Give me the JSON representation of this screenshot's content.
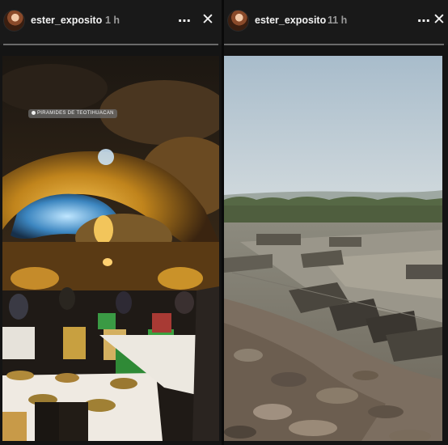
{
  "stories": [
    {
      "username": "ester_exposito",
      "time": "1 h",
      "more_icon": "⋯",
      "close_icon": "✕",
      "location_sticker": "PIRAMIDES DE TEOTIHUACAN",
      "progress": 1.0
    },
    {
      "username": "ester_exposito",
      "time": "11 h",
      "more_icon": "⋯",
      "close_icon": "✕",
      "progress": 1.0
    }
  ],
  "colors": {
    "header_bg": "#191919",
    "text_primary": "#f2f2f2",
    "text_secondary": "#9a9a9a",
    "progress": "#6a6a6a"
  }
}
